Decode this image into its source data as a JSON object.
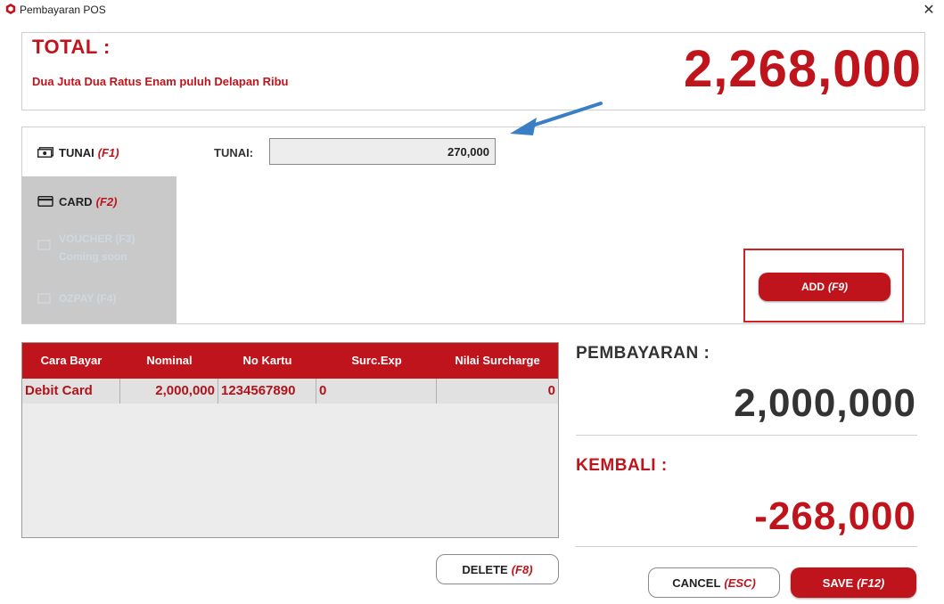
{
  "window": {
    "title": "Pembayaran POS",
    "close_glyph": "✕"
  },
  "total": {
    "label": "TOTAL :",
    "words": "Dua Juta Dua Ratus Enam puluh Delapan Ribu",
    "amount": "2,268,000"
  },
  "methods": [
    {
      "name": "TUNAI",
      "key": "(F1)",
      "icon": "cash-icon",
      "active": true
    },
    {
      "name": "CARD",
      "key": "(F2)",
      "icon": "card-icon",
      "active": false
    },
    {
      "name": "VOUCHER (F3)",
      "sub": "Coming soon",
      "icon": "voucher-icon",
      "active": false,
      "disabled": true
    },
    {
      "name": "OZPAY (F4)",
      "icon": "ozpay-icon",
      "active": false,
      "disabled": true
    }
  ],
  "cash": {
    "label": "TUNAI:",
    "value": "270,000"
  },
  "add_button": {
    "label": "ADD",
    "key": "(F9)"
  },
  "table": {
    "headers": [
      "Cara Bayar",
      "Nominal",
      "No Kartu",
      "Surc.Exp",
      "Nilai Surcharge"
    ],
    "rows": [
      [
        "Debit Card",
        "2,000,000",
        "1234567890",
        "0",
        "0"
      ]
    ]
  },
  "summary": {
    "payment_label": "PEMBAYARAN :",
    "payment_amount": "2,000,000",
    "change_label": "KEMBALI :",
    "change_amount": "-268,000"
  },
  "buttons": {
    "delete": {
      "label": "DELETE",
      "key": "(F8)"
    },
    "cancel": {
      "label": "CANCEL",
      "key": "(ESC)"
    },
    "save": {
      "label": "SAVE",
      "key": "(F12)"
    }
  },
  "colors": {
    "accent": "#c0141c",
    "arrow": "#3a7fc6",
    "rail": "#c9c9c9"
  }
}
